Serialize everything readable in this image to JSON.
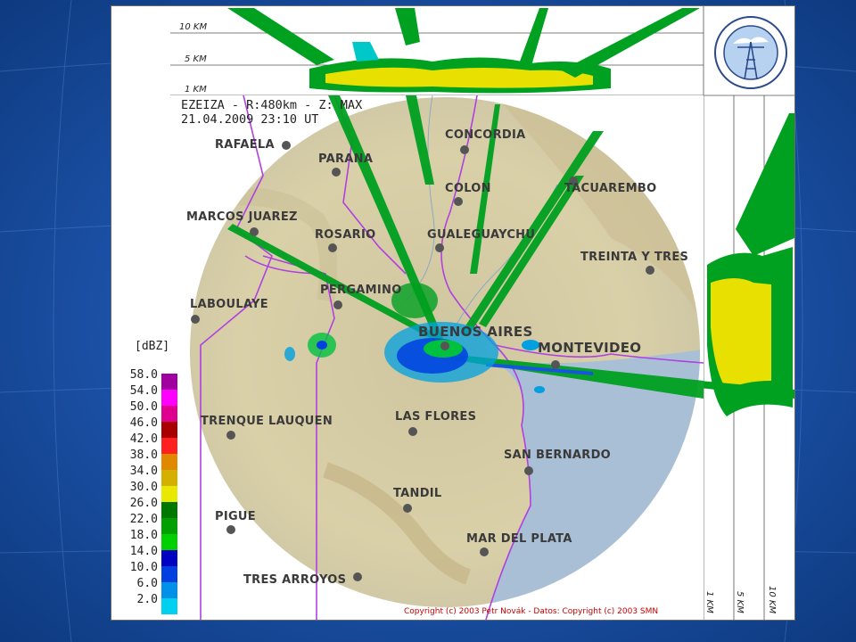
{
  "header": {
    "station_line": "EZEIZA - R:480km - Z: MAX",
    "datetime_line": "21.04.2009 23:10 UT"
  },
  "top_axis": {
    "km10": "10 KM",
    "km5": "5 KM",
    "km1": "1 KM"
  },
  "side_axis": {
    "km1": "1 KM",
    "km5": "5 KM",
    "km10": "10 KM"
  },
  "cities": [
    {
      "id": "rafaela",
      "label": "RAFAELA"
    },
    {
      "id": "parana",
      "label": "PARANA"
    },
    {
      "id": "concordia",
      "label": "CONCORDIA"
    },
    {
      "id": "colon",
      "label": "COLON"
    },
    {
      "id": "tacuarembo",
      "label": "TACUAREMBO"
    },
    {
      "id": "marcos-juarez",
      "label": "MARCOS JUAREZ"
    },
    {
      "id": "rosario",
      "label": "ROSARIO"
    },
    {
      "id": "gualeguaychu",
      "label": "GUALEGUAYCHU"
    },
    {
      "id": "treinta-y-tres",
      "label": "TREINTA Y TRES"
    },
    {
      "id": "laboulaye",
      "label": "LABOULAYE"
    },
    {
      "id": "pergamino",
      "label": "PERGAMINO"
    },
    {
      "id": "buenos-aires",
      "label": "BUENOS AIRES"
    },
    {
      "id": "montevideo",
      "label": "MONTEVIDEO"
    },
    {
      "id": "trenque-lauquen",
      "label": "TRENQUE LAUQUEN"
    },
    {
      "id": "las-flores",
      "label": "LAS FLORES"
    },
    {
      "id": "san-bernardo",
      "label": "SAN BERNARDO"
    },
    {
      "id": "tandil",
      "label": "TANDIL"
    },
    {
      "id": "pigue",
      "label": "PIGUE"
    },
    {
      "id": "mar-del-plata",
      "label": "MAR DEL PLATA"
    },
    {
      "id": "tres-arroyos",
      "label": "TRES ARROYOS"
    }
  ],
  "legend": {
    "unit": "[dBZ]",
    "entries": [
      {
        "value": "58.0",
        "color": "#a000a0"
      },
      {
        "value": "54.0",
        "color": "#ff00ff"
      },
      {
        "value": "50.0",
        "color": "#e00090"
      },
      {
        "value": "46.0",
        "color": "#a80000"
      },
      {
        "value": "42.0",
        "color": "#ff2020"
      },
      {
        "value": "38.0",
        "color": "#e08800"
      },
      {
        "value": "34.0",
        "color": "#d4b000"
      },
      {
        "value": "30.0",
        "color": "#e8e800"
      },
      {
        "value": "26.0",
        "color": "#007800"
      },
      {
        "value": "22.0",
        "color": "#00a000"
      },
      {
        "value": "18.0",
        "color": "#00d000"
      },
      {
        "value": "14.0",
        "color": "#0000c0"
      },
      {
        "value": "10.0",
        "color": "#0040e0"
      },
      {
        "value": "6.0",
        "color": "#0090e8"
      },
      {
        "value": "2.0",
        "color": "#00d0f0"
      }
    ],
    "top_swatch_color": "#ffffff"
  },
  "copyright": "Copyright (c) 2003 Petr Novák - Datos: Copyright (c) 2003 SMN",
  "colors": {
    "slide_background": "#1a4f9c",
    "land": "#d8cfa4",
    "sea": "#a9bfd6",
    "borders": "#b040e0"
  }
}
